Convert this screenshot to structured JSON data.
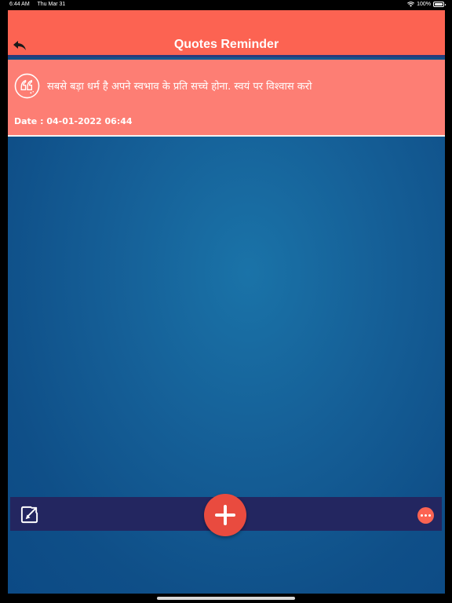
{
  "status_bar": {
    "time": "6:44 AM",
    "date": "Thu Mar 31",
    "battery_percent": "100%",
    "battery_level": 1.0
  },
  "navbar": {
    "title": "Quotes Reminder"
  },
  "quotes": [
    {
      "text": "सबसे बड़ा धर्म है अपने स्वभाव के प्रति सच्चे होना. स्वयं पर विश्वास करो",
      "date": "Date : 04-01-2022 06:44"
    }
  ],
  "colors": {
    "accent": "#fc6352",
    "card": "#fd7e74",
    "toolbar": "#232660",
    "background": "#155f97"
  },
  "icons": {
    "back": "back-arrow-icon",
    "quote": "quote-marks-icon",
    "share": "share-icon",
    "add": "plus-icon",
    "more": "more-dots-icon"
  }
}
